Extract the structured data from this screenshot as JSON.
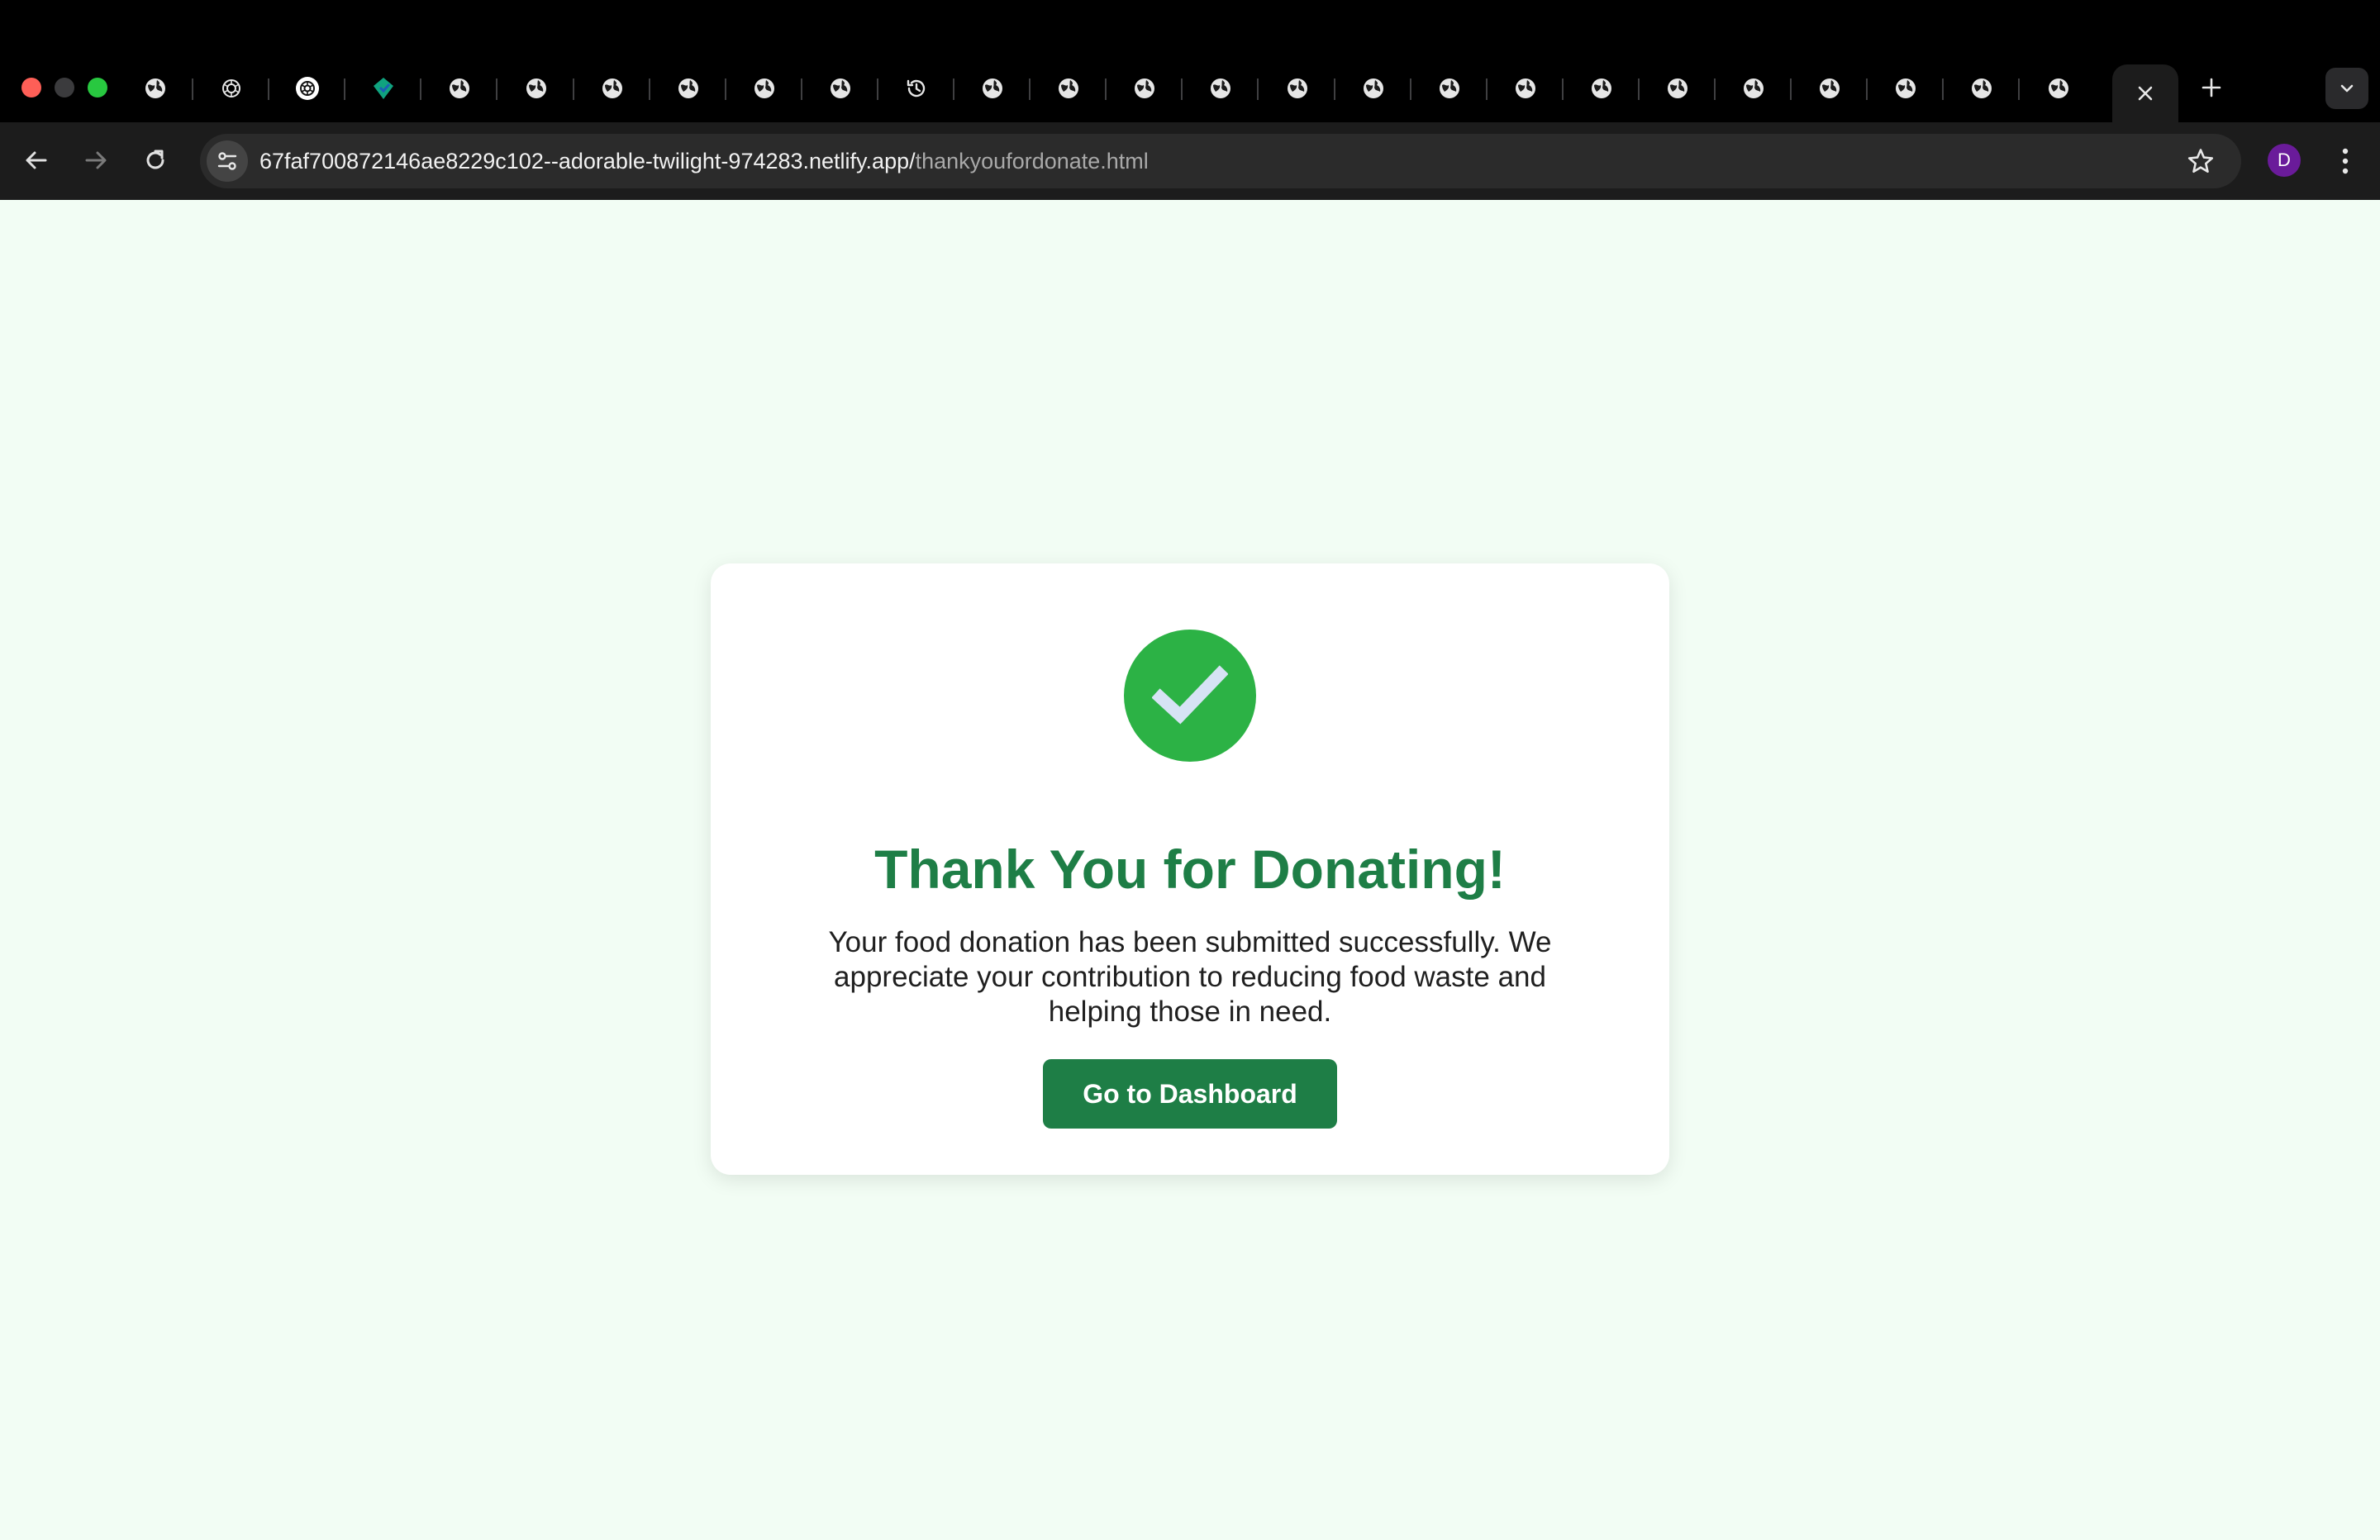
{
  "browser": {
    "address_bar": {
      "host": "67faf700872146ae8229c102--adorable-twilight-974283.netlify.app/",
      "path": "thankyoufordonate.html"
    },
    "profile_initial": "D",
    "tabs": [
      {
        "icon": "globe-icon"
      },
      {
        "icon": "openai-icon"
      },
      {
        "icon": "openai-white-icon"
      },
      {
        "icon": "teal-app-icon"
      },
      {
        "icon": "globe-icon"
      },
      {
        "icon": "globe-icon"
      },
      {
        "icon": "globe-icon"
      },
      {
        "icon": "globe-icon"
      },
      {
        "icon": "globe-icon"
      },
      {
        "icon": "globe-icon"
      },
      {
        "icon": "history-icon"
      },
      {
        "icon": "globe-icon"
      },
      {
        "icon": "globe-icon"
      },
      {
        "icon": "globe-icon"
      },
      {
        "icon": "globe-icon"
      },
      {
        "icon": "globe-icon"
      },
      {
        "icon": "globe-icon"
      },
      {
        "icon": "globe-icon"
      },
      {
        "icon": "globe-icon"
      },
      {
        "icon": "globe-icon"
      },
      {
        "icon": "globe-icon"
      },
      {
        "icon": "globe-icon"
      },
      {
        "icon": "globe-icon"
      },
      {
        "icon": "globe-icon"
      },
      {
        "icon": "globe-icon"
      },
      {
        "icon": "globe-icon"
      }
    ]
  },
  "page": {
    "title": "Thank You for Donating!",
    "message": "Your food donation has been submitted successfully. We appreciate your contribution to reducing food waste and helping those in need.",
    "button_label": "Go to Dashboard"
  },
  "colors": {
    "page_background": "#f2fdf4",
    "success_green": "#2cb245",
    "brand_green": "#1e7e46",
    "checkmark": "#d6e3f4"
  }
}
